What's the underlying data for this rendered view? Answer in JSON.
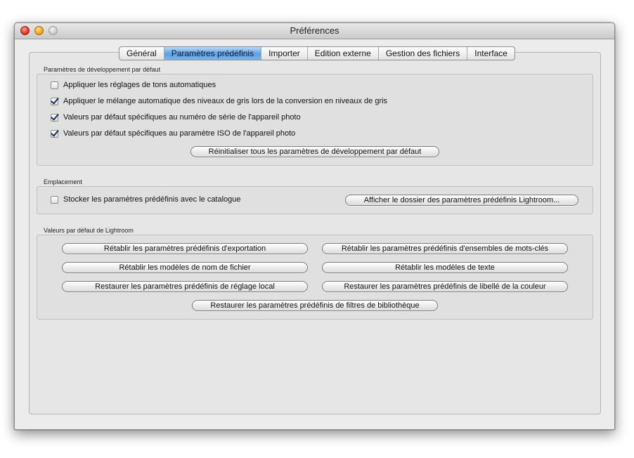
{
  "window": {
    "title": "Préférences"
  },
  "tabs": [
    {
      "label": "Général",
      "selected": false
    },
    {
      "label": "Paramètres prédéfinis",
      "selected": true
    },
    {
      "label": "Importer",
      "selected": false
    },
    {
      "label": "Edition externe",
      "selected": false
    },
    {
      "label": "Gestion des fichiers",
      "selected": false
    },
    {
      "label": "Interface",
      "selected": false
    }
  ],
  "develop_defaults": {
    "label": "Paramètres de développement par défaut",
    "checkboxes": [
      {
        "label": "Appliquer les réglages de tons automatiques",
        "checked": false
      },
      {
        "label": "Appliquer le mélange automatique des niveaux de gris lors de la conversion en niveaux de gris",
        "checked": true
      },
      {
        "label": "Valeurs par défaut spécifiques au numéro de série de l'appareil photo",
        "checked": true
      },
      {
        "label": "Valeurs par défaut spécifiques au paramètre ISO de l'appareil photo",
        "checked": true
      }
    ],
    "reset_button": "Réinitialiser tous les paramètres de développement par défaut"
  },
  "location": {
    "label": "Emplacement",
    "store_checkbox": {
      "label": "Stocker les paramètres prédéfinis avec le catalogue",
      "checked": false
    },
    "show_folder_button": "Afficher le dossier des paramètres prédéfinis Lightroom..."
  },
  "lightroom_defaults": {
    "label": "Valeurs par défaut de Lightroom",
    "buttons": [
      "Rétablir les paramètres prédéfinis d'exportation",
      "Rétablir les paramètres prédéfinis d'ensembles de mots-clés",
      "Rétablir les modèles de nom de fichier",
      "Rétablir les modèles de texte",
      "Restaurer les paramètres prédéfinis de réglage local",
      "Restaurer les paramètres prédéfinis de libellé de la couleur",
      "Restaurer les paramètres prédéfinis de filtres de bibliothèque"
    ]
  },
  "colors": {
    "selected_tab": "#5d9ee2",
    "checkmark": "#15315f",
    "close_light": "#d6281a",
    "minimize_light": "#e79a14"
  }
}
